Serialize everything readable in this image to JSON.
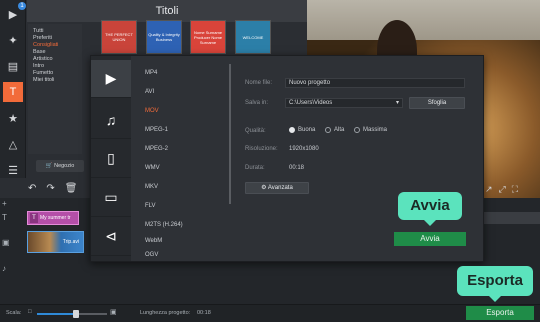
{
  "panel": {
    "title": "Titoli",
    "categories": [
      "Tutti",
      "Preferiti",
      "Consigliati",
      "Base",
      "Artistico",
      "Intro",
      "Fumetto",
      "Miei titoli"
    ],
    "selected_category": "Consigliati",
    "thumbnails": [
      {
        "text": "THE PERFECT UNION"
      },
      {
        "text": "Quality & Integrity Business"
      },
      {
        "text": "Nome Surname Producer Nome Surname"
      },
      {
        "text": "WELCOME"
      }
    ],
    "store_button": "Negozio"
  },
  "toolbar": {
    "icons": [
      "import-icon",
      "magic-wand-icon",
      "filmstrip-icon",
      "title-t-icon",
      "sticker-star-icon",
      "shapes-icon",
      "list-icon"
    ],
    "badge": "1"
  },
  "export_dialog": {
    "formats": [
      "MP4",
      "AVI",
      "MOV",
      "MPEG-1",
      "MPEG-2",
      "WMV",
      "MKV",
      "FLV",
      "M2TS (H.264)",
      "WebM",
      "OGV"
    ],
    "selected_format": "MOV",
    "file_name_label": "Nome file:",
    "file_name_value": "Nuovo progetto",
    "save_in_label": "Salva in:",
    "save_in_value": "C:\\Users\\Videos",
    "browse_button": "Sfoglia",
    "quality_label": "Qualità:",
    "quality_options": [
      "Buona",
      "Alta",
      "Massima"
    ],
    "quality_selected": "Buona",
    "resolution_label": "Risoluzione:",
    "resolution_value": "1920x1080",
    "duration_label": "Durata:",
    "duration_value": "00:18",
    "advanced_button": "Avanzata",
    "start_button": "Avvia"
  },
  "tooltips": {
    "start": "Avvia",
    "export": "Esporta"
  },
  "timeline": {
    "title_clip": "My summer tr",
    "video_clip": "Trip.avi"
  },
  "statusbar": {
    "scale_label": "Scala:",
    "scale_value": 0.55,
    "project_length_label": "Lunghezza progetto:",
    "project_length_value": "00:18",
    "export_button": "Esporta"
  },
  "colors": {
    "accent": "#f26b3a",
    "export_green": "#1f8c48",
    "tooltip": "#5be3bd"
  }
}
